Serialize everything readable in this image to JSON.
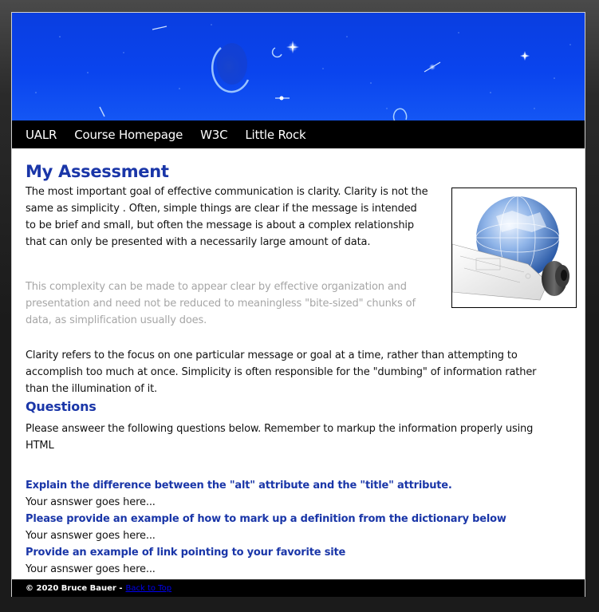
{
  "nav": {
    "links": [
      {
        "label": "UALR"
      },
      {
        "label": "Course Homepage"
      },
      {
        "label": "W3C"
      },
      {
        "label": "Little Rock"
      }
    ]
  },
  "main": {
    "title": "My Assessment",
    "paragraphs": [
      "The most important goal of effective communication is clarity. Clarity is not the same as simplicity . Often, simple things are clear if the message is intended to be brief and small, but often the message is about a complex relationship that can only be presented with a necessarily large amount of data.",
      "This complexity can be made to appear clear by effective organization and presentation and need not be reduced to meaningless \"bite-sized\" chunks of data, as simplification usually does.",
      "Clarity refers to the focus on one particular message or goal at a time, rather than attempting to accomplish too much at once. Simplicity is often responsible for the \"dumbing\" of information rather than the illumination of it."
    ],
    "image": {
      "icon": "globe-blueprint-image"
    }
  },
  "questions": {
    "heading": "Questions",
    "intro": "Please answeer the following questions below. Remember to markup the information properly using HTML",
    "items": [
      {
        "question": "Explain the difference between the \"alt\" attribute and the \"title\" attribute.",
        "answer": "Your asnswer goes here..."
      },
      {
        "question": "Please provide an example of how to mark up a definition from the dictionary below",
        "answer": "Your asnswer goes here..."
      },
      {
        "question": "Provide an example of link pointing to your favorite site",
        "answer": "Your asnswer goes here..."
      }
    ]
  },
  "footer": {
    "copyright": "© 2020 Bruce Bauer -",
    "back_to_top": "Back to Top"
  },
  "colors": {
    "heading": "#1a36a8",
    "banner": "#0a44ee",
    "nav_bg": "#000000",
    "muted_text": "#a6a6a6",
    "link": "#0000ee"
  }
}
